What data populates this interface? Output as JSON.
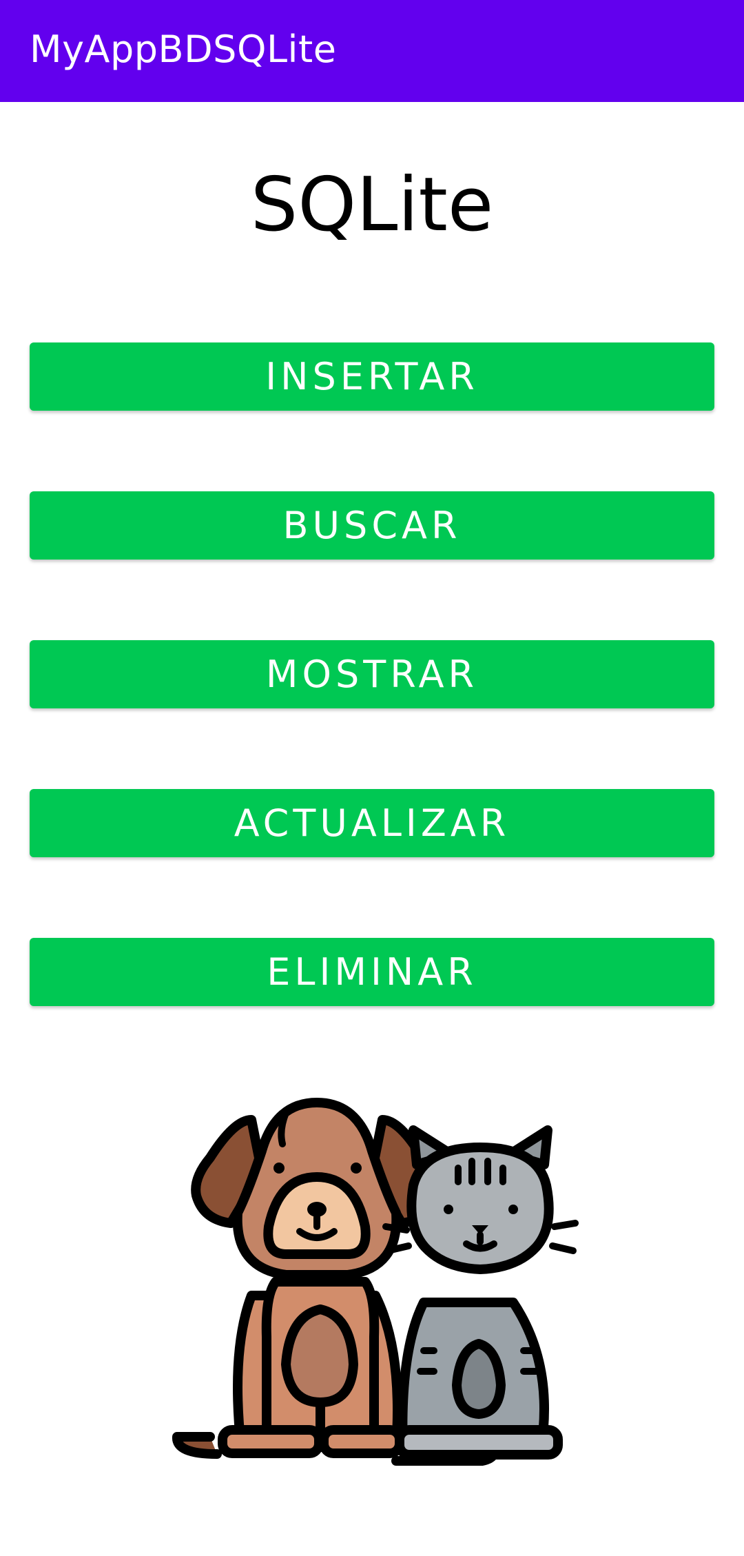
{
  "app_bar": {
    "title": "MyAppBDSQLite",
    "background": "#6200EE"
  },
  "main": {
    "heading": "SQLite",
    "button_color": "#00C853",
    "buttons": [
      {
        "label": "INSERTAR"
      },
      {
        "label": "BUSCAR"
      },
      {
        "label": "MOSTRAR"
      },
      {
        "label": "ACTUALIZAR"
      },
      {
        "label": "ELIMINAR"
      }
    ],
    "illustration": "dog-and-cat-icon"
  }
}
